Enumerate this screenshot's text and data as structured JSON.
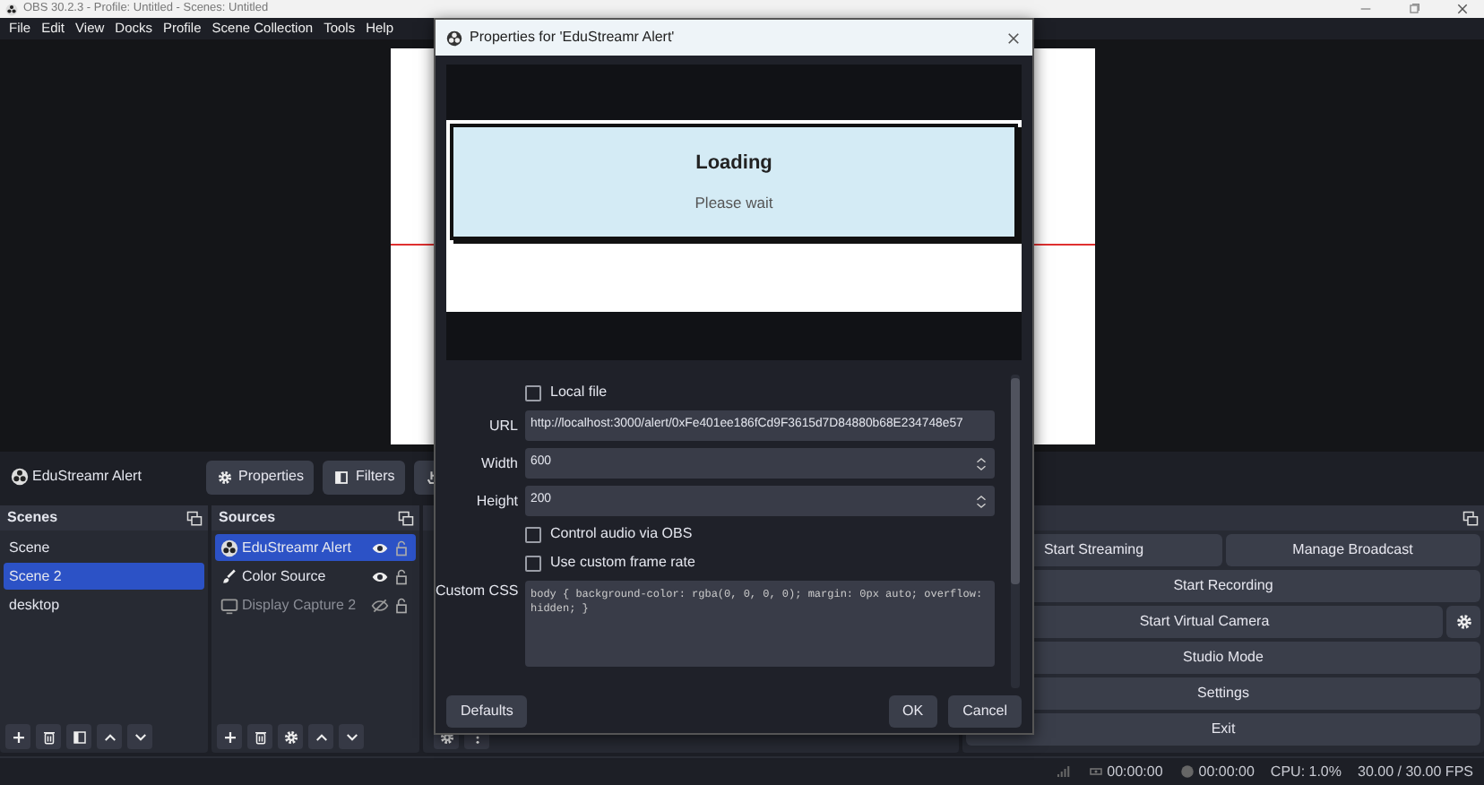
{
  "window": {
    "title": "OBS 30.2.3 - Profile: Untitled - Scenes: Untitled"
  },
  "menu": [
    "File",
    "Edit",
    "View",
    "Docks",
    "Profile",
    "Scene Collection",
    "Tools",
    "Help"
  ],
  "source_toolbar": {
    "source_name": "EduStreamr Alert",
    "buttons": [
      {
        "label": "Properties",
        "kind": "gear"
      },
      {
        "label": "Filters",
        "kind": "filter"
      },
      {
        "kind": "interact"
      }
    ]
  },
  "scenes": {
    "title": "Scenes",
    "items": [
      {
        "label": "Scene",
        "selected": false
      },
      {
        "label": "Scene 2",
        "selected": true
      },
      {
        "label": "desktop",
        "selected": false
      }
    ]
  },
  "sources": {
    "title": "Sources",
    "items": [
      {
        "label": "EduStreamr Alert",
        "kind": "browser",
        "selected": true,
        "visible": true
      },
      {
        "label": "Color Source",
        "kind": "color",
        "selected": false,
        "visible": true
      },
      {
        "label": "Display Capture 2",
        "kind": "display",
        "selected": false,
        "visible": false
      }
    ]
  },
  "controls": {
    "rows": [
      {
        "kind": "plain",
        "buttons": [
          "Start Streaming",
          "Manage Broadcast"
        ]
      },
      {
        "kind": "plain",
        "buttons": [
          "Start Recording"
        ]
      },
      {
        "kind": "with_settings",
        "buttons": [
          "Start Virtual Camera"
        ]
      },
      {
        "kind": "plain",
        "buttons": [
          "Studio Mode"
        ]
      },
      {
        "kind": "plain",
        "buttons": [
          "Settings"
        ]
      },
      {
        "kind": "plain",
        "buttons": [
          "Exit"
        ]
      }
    ]
  },
  "status_bar": {
    "stream_time": "00:00:00",
    "record_time": "00:00:00",
    "cpu": "CPU: 1.0%",
    "fps": "30.00 / 30.00 FPS"
  },
  "dialog": {
    "title": "Properties for 'EduStreamr Alert'",
    "preview": {
      "heading": "Loading",
      "subtext": "Please wait"
    },
    "fields": [
      {
        "kind": "checkbox",
        "label": "Local file",
        "checked": false
      },
      {
        "kind": "text",
        "label": "URL",
        "value": "http://localhost:3000/alert/0xFe401ee186fCd9F3615d7D84880b68E234748e57"
      },
      {
        "kind": "number",
        "label": "Width",
        "value": "600"
      },
      {
        "kind": "number",
        "label": "Height",
        "value": "200"
      },
      {
        "kind": "checkbox",
        "label": "Control audio via OBS",
        "checked": false
      },
      {
        "kind": "checkbox",
        "label": "Use custom frame rate",
        "checked": false
      },
      {
        "kind": "textarea",
        "label": "Custom CSS",
        "value": "body { background-color: rgba(0, 0, 0, 0); margin: 0px auto; overflow: hidden; }"
      }
    ],
    "buttons": {
      "defaults": "Defaults",
      "ok": "OK",
      "cancel": "Cancel"
    }
  }
}
